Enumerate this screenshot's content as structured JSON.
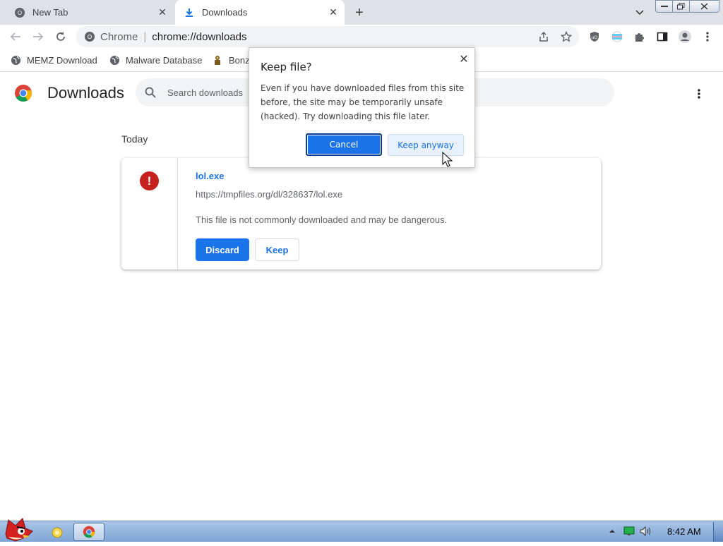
{
  "tabs": [
    {
      "label": "New Tab",
      "icon": "chrome-icon",
      "active": false
    },
    {
      "label": "Downloads",
      "icon": "download-icon",
      "active": true
    }
  ],
  "toolbar": {
    "site_label": "Chrome",
    "separator": "|",
    "url": "chrome://downloads"
  },
  "bookmarks": [
    {
      "label": "MEMZ Download",
      "icon": "globe-icon"
    },
    {
      "label": "Malware Database",
      "icon": "globe-icon"
    },
    {
      "label": "Bonz",
      "icon": "bonzi-icon"
    }
  ],
  "page": {
    "title": "Downloads",
    "search_placeholder": "Search downloads",
    "date_heading": "Today"
  },
  "download": {
    "filename": "lol.exe",
    "url": "https://tmpfiles.org/dl/328637/lol.exe",
    "warning": "This file is not commonly downloaded and may be dangerous.",
    "discard_label": "Discard",
    "keep_label": "Keep",
    "status_icon": "error-icon"
  },
  "dialog": {
    "title": "Keep file?",
    "body": "Even if you have downloaded files from this site before, the site may be temporarily unsafe (hacked). Try downloading this file later.",
    "cancel_label": "Cancel",
    "keep_label": "Keep anyway"
  },
  "taskbar": {
    "clock": "8:42 AM"
  },
  "colors": {
    "accent": "#1a73e8",
    "danger": "#c5221f",
    "tabstrip": "#dee1e6",
    "taskbar": "#8fb1dd"
  }
}
